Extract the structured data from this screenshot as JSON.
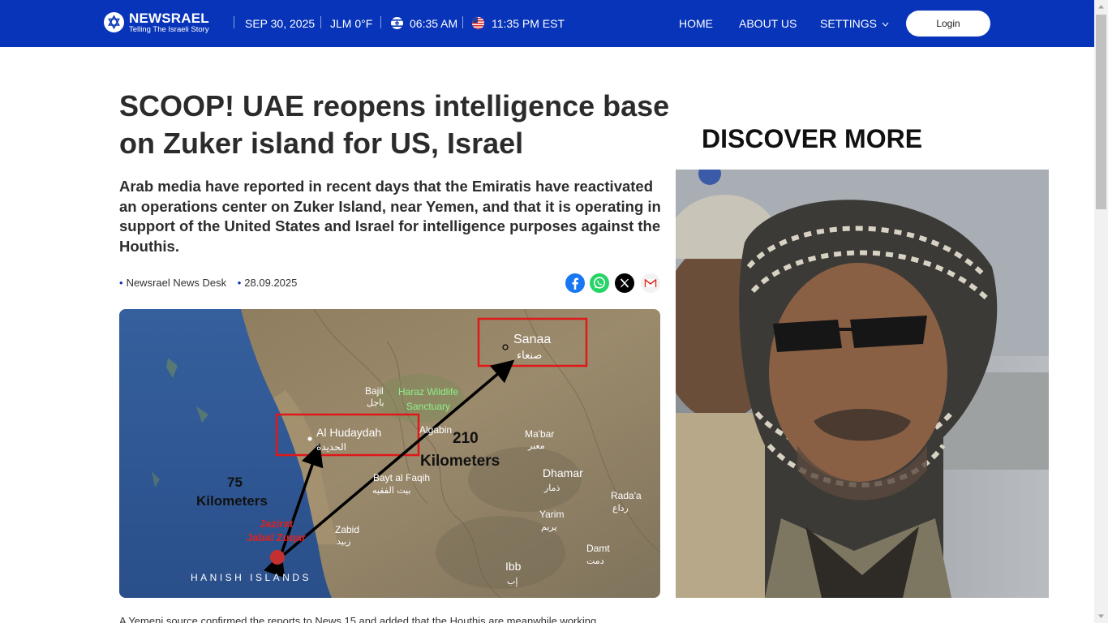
{
  "header": {
    "brand": "NEWSRAEL",
    "tagline": "Telling The Israeli Story",
    "date": "SEP 30, 2025",
    "weather": "JLM 0°F",
    "local_time": "06:35 AM",
    "us_time": "11:35 PM EST",
    "nav": {
      "home": "HOME",
      "about": "ABOUT US",
      "settings": "SETTINGS"
    },
    "login": "Login",
    "colors": {
      "bar": "#0734b8",
      "text": "#ffffff"
    }
  },
  "article": {
    "headline": "SCOOP! UAE reopens intelligence base on Zuker island for US, Israel",
    "lead": "Arab media have reported in recent days that the Emiratis have reactivated an operations center on Zuker Island, near Yemen, and that it is operating in support of the United States and Israel for intelligence purposes against the Houthis.",
    "author": "Newsrael News Desk",
    "date": "28.09.2025",
    "share_icons": [
      "facebook-icon",
      "whatsapp-icon",
      "x-icon",
      "gmail-icon"
    ],
    "body_start": "A Yemeni source confirmed the reports to News 15 and added that the Houthis are meanwhile working"
  },
  "map": {
    "labels": {
      "sanaa": "Sanaa",
      "sanaa_ar": "صنعاء",
      "hudaydah": "Al Hudaydah",
      "hudaydah_ar": "الحديدة",
      "bajil": "Bajil",
      "bajil_ar": "باجل",
      "haraz": "Haraz Wildlife",
      "sanctuary": "Sanctuary",
      "mabar": "Ma'bar",
      "mabar_ar": "معبر",
      "algabin": "Algabin",
      "bayt": "Bayt al Faqih",
      "bayt_ar": "بيت الفقيه",
      "dhamar": "Dhamar",
      "dhamar_ar": "ذمار",
      "rada": "Rada'a",
      "rada_ar": "رداع",
      "yarim": "Yarim",
      "yarim_ar": "يريم",
      "zabid": "Zabid",
      "zabid_ar": "زبيد",
      "damt": "Damt",
      "damt_ar": "دمت",
      "ibb": "Ibb",
      "ibb_ar": "إب",
      "jazirat": "Jazirat",
      "jabal": "Jabal Zuqar",
      "hanish": "HANISH ISLANDS",
      "dist_short_num": "75",
      "dist_short_unit": "Kilometers",
      "dist_long_num": "210",
      "dist_long_unit": "Kilometers"
    }
  },
  "sidebar": {
    "title": "DISCOVER MORE"
  }
}
